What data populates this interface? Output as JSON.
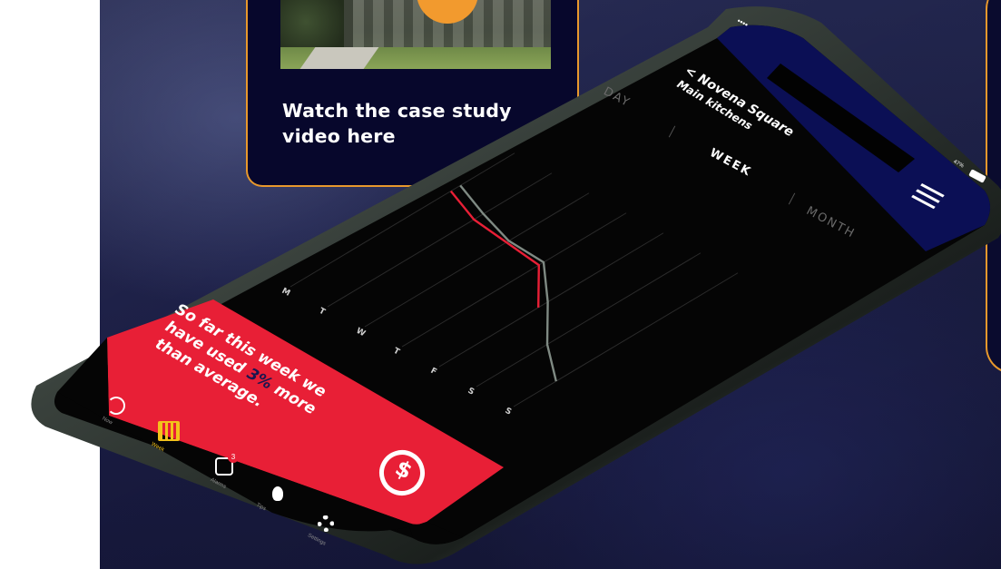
{
  "case_study": {
    "title": "Watch the case study video here"
  },
  "app": {
    "location_line1": "< Novena Square",
    "location_line2": "Main kitchens",
    "status_signal": "••••",
    "battery_label": "47%"
  },
  "tabs": [
    {
      "label": "DAY",
      "active": false
    },
    {
      "label": "WEEK",
      "active": true
    },
    {
      "label": "MONTH",
      "active": false
    }
  ],
  "chart_data": {
    "type": "line",
    "categories": [
      "M",
      "T",
      "W",
      "T",
      "F",
      "S",
      "S"
    ],
    "series": [
      {
        "color": "#e81f36",
        "values": [
          68,
          62,
          60,
          58,
          42,
          null,
          null
        ]
      },
      {
        "color": "#7f8a83",
        "values": [
          72,
          66,
          61,
          60,
          46,
          30,
          18
        ]
      }
    ]
  },
  "banner": {
    "text_before": "So far this week we have used ",
    "percent": "3%",
    "text_after": " more than average."
  },
  "nav": [
    {
      "label": "Now",
      "icon": "gauge-icon"
    },
    {
      "label": "Week",
      "icon": "calendar-icon"
    },
    {
      "label": "Alarms",
      "icon": "alarm-icon",
      "badge": "3"
    },
    {
      "label": "Tips",
      "icon": "lightbulb-icon"
    },
    {
      "label": "Settings",
      "icon": "gear-icon"
    }
  ],
  "colors": {
    "accent_orange": "#e8982c",
    "banner_red": "#e81f36",
    "header_navy": "#0b0f55",
    "page_bg": "#1c1f47"
  }
}
